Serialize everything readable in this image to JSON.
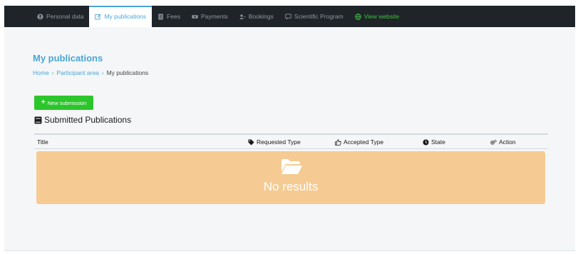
{
  "nav": {
    "items": [
      {
        "label": "Personal data",
        "icon": "user-circle-icon",
        "active": false
      },
      {
        "label": "My publications",
        "icon": "edit-icon",
        "active": true
      },
      {
        "label": "Fees",
        "icon": "receipt-icon",
        "active": false
      },
      {
        "label": "Payments",
        "icon": "money-icon",
        "active": false
      },
      {
        "label": "Bookings",
        "icon": "user-key-icon",
        "active": false
      },
      {
        "label": "Scientific Program",
        "icon": "speech-icon",
        "active": false
      },
      {
        "label": "View website",
        "icon": "globe-icon",
        "active": false
      }
    ]
  },
  "page": {
    "title": "My publications",
    "breadcrumb": [
      "Home",
      "Participant area",
      "My publications"
    ]
  },
  "actions": {
    "new_submission": "New submission"
  },
  "section": {
    "title": "Submitted Publications"
  },
  "table": {
    "columns": [
      "Title",
      "Requested Type",
      "Accepted Type",
      "State",
      "Action"
    ],
    "empty_message": "No results"
  },
  "colors": {
    "accent": "#4aa6d8",
    "nav_bg": "#1f2429",
    "success": "#2cc62c",
    "empty_bg": "#f5cb93"
  }
}
